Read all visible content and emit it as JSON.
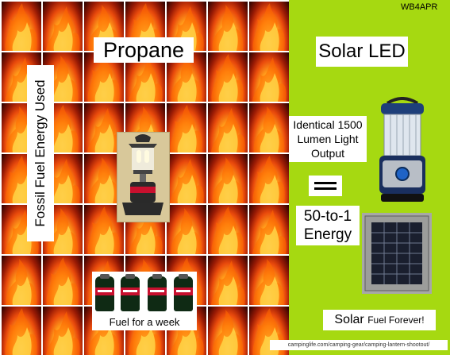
{
  "propane": {
    "title": "Propane",
    "side_label": "Fossil Fuel Energy Used",
    "lantern_icon": "propane-lantern-icon",
    "fuel_caption": "Fuel for a week",
    "canister_count": 4,
    "canister_icon": "propane-canister-icon",
    "flame_icon": "fire-icon",
    "flame_count": 49
  },
  "solar": {
    "title": "Solar LED",
    "identical_text": "Identical 1500 Lumen Light Output",
    "equals_symbol": "=",
    "ratio_text": "50-to-1 Energy",
    "forever_main": "Solar",
    "forever_small": "Fuel Forever!",
    "lantern_icon": "led-lantern-icon",
    "panel_icon": "solar-panel-icon"
  },
  "callsign": "WB4APR",
  "credit_url": "campinglife.com/camping-gear/camping-lantern-shootout/",
  "colors": {
    "green_panel": "#a6d911",
    "flame_hot": "#ffd23a",
    "flame_mid": "#e94a0c",
    "flame_dark": "#260000",
    "canister_green": "#0f2a14",
    "canister_red": "#c8102e"
  }
}
